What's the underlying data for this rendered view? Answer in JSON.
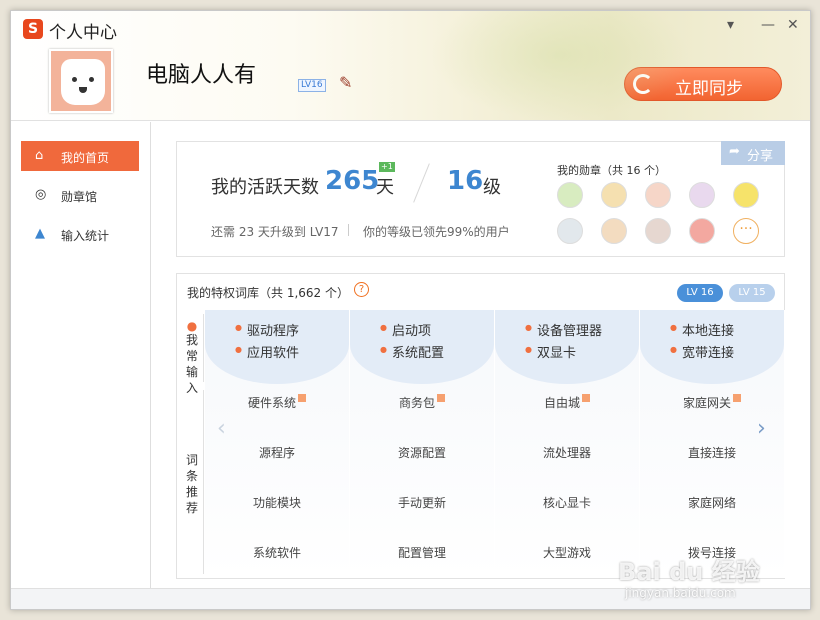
{
  "window": {
    "title": "个人中心",
    "logo_glyph": "S"
  },
  "controls": {
    "menu": "▾",
    "minimize": "—",
    "close": "✕"
  },
  "profile": {
    "username": "电脑人人有",
    "level_tag": "LV16",
    "sync_label": "立即同步"
  },
  "sidebar": {
    "items": [
      {
        "label": "我的首页",
        "icon": "home-icon",
        "glyph": "⌂",
        "active": true
      },
      {
        "label": "勋章馆",
        "icon": "medal-icon",
        "glyph": "◎",
        "active": false
      },
      {
        "label": "输入统计",
        "icon": "stats-icon",
        "glyph": "▲",
        "active": false
      }
    ]
  },
  "stats": {
    "active_label": "我的活跃天数",
    "active_days": "265",
    "active_unit": "天",
    "plus": "+1",
    "level": "16",
    "level_unit": "级",
    "next_level": "还需 23 天升级到 LV17",
    "rank": "你的等级已领先99%的用户",
    "share": "分享"
  },
  "medals": {
    "title": "我的勋章（共 16 个）",
    "row1": [
      "#d8ecc0",
      "#f5e0b0",
      "#f6d6c8",
      "#e9d9ee",
      "#f6e36a"
    ],
    "row2": [
      "#e2e8ec",
      "#f3dcc0",
      "#e6d7d0",
      "#f3a8a0"
    ],
    "more": "···"
  },
  "lexicon": {
    "title": "我的特权词库（共 1,662 个）",
    "help": "?",
    "tabs": [
      "LV 16",
      "LV 15"
    ],
    "section_common": "我常输入",
    "section_recommend": "词条推荐",
    "columns": [
      {
        "bullets": [
          "驱动程序",
          "应用软件"
        ],
        "words": [
          "硬件系统",
          "源程序",
          "功能模块",
          "系统软件"
        ],
        "hot": [
          true,
          false,
          false,
          false
        ]
      },
      {
        "bullets": [
          "启动项",
          "系统配置"
        ],
        "words": [
          "商务包",
          "资源配置",
          "手动更新",
          "配置管理"
        ],
        "hot": [
          true,
          false,
          false,
          false
        ]
      },
      {
        "bullets": [
          "设备管理器",
          "双显卡"
        ],
        "words": [
          "自由城",
          "流处理器",
          "核心显卡",
          "大型游戏"
        ],
        "hot": [
          true,
          false,
          false,
          false
        ]
      },
      {
        "bullets": [
          "本地连接",
          "宽带连接"
        ],
        "words": [
          "家庭网关",
          "直接连接",
          "家庭网络",
          "拨号连接"
        ],
        "hot": [
          true,
          false,
          false,
          false
        ]
      }
    ],
    "prev": "‹",
    "next": "›"
  },
  "watermark": {
    "brand": "Bai du 经验",
    "url": "jingyan.baidu.com"
  },
  "colors": {
    "accent": "#f0693c",
    "blue": "#3d86d0"
  }
}
